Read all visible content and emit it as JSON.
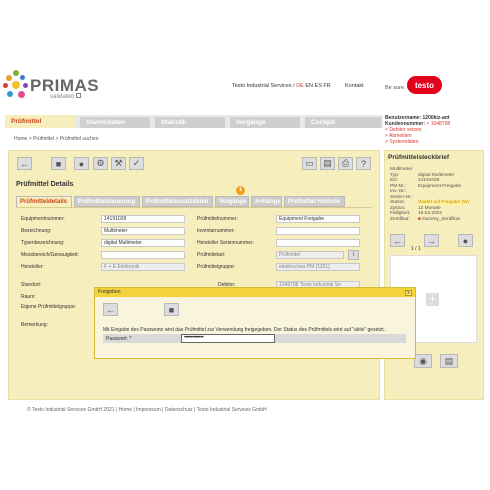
{
  "brand": {
    "name": "PRIMAS",
    "tagline": "validated"
  },
  "top": {
    "company": "Testo Industrial Services",
    "lang_sep": " / ",
    "lang_active": "DE",
    "langs_rest": " EN ES FR",
    "contact": "Kontakt",
    "be_sure": "Be sure.",
    "testo_logo": "testo"
  },
  "colors": {
    "accent": "#c9481d",
    "panel": "#f6eebc",
    "dialog_header": "#f2d33a",
    "red": "#e2001a"
  },
  "nav": {
    "items": [
      "Prüfmittel",
      "Stammdaten",
      "Statistik",
      "Vorgänge",
      "Cockpit"
    ],
    "active_index": 0
  },
  "user": {
    "label_user": "Benutzername:",
    "user": "1200kiz-ant",
    "label_customer": "Kundennummer:",
    "customer": "1048798",
    "links": [
      "Debitor setzen",
      "Abmelden",
      "Systemdaten"
    ]
  },
  "breadcrumb": "Home > Prüfmittel > Prüfmittel suchen",
  "main": {
    "title": "Prüfmittel Details",
    "tabs": [
      "Prüfmitteldetails",
      "Prüfmittelsteuerung",
      "Prüfmittelzusatzdaten",
      "Vorgänge",
      "Anhänge",
      "Prüfmittel Historie"
    ],
    "active_tab": 0,
    "badge": "1",
    "fields": {
      "equipmentnummer_label": "Equipmentnummer:",
      "equipmentnummer": "14191028",
      "bezeichnung_label": "Bezeichnung:",
      "bezeichnung": "Multimeter",
      "typenbezeichnung_label": "Typenbezeichnung:",
      "typenbezeichnung": "digital Multimeter",
      "messbereich_label": "Messbereich/Genauigkeit:",
      "messbereich": "",
      "hersteller_label": "Hersteller:",
      "hersteller": "F + E Elektronik",
      "pruefmittelnummer_label": "Prüfmittelnummer:",
      "pruefmittelnummer": "Equipment Freigabe",
      "inventarnummer_label": "Inventarnummer:",
      "inventarnummer": "",
      "herstellerserien_label": "Hersteller Seriennummer:",
      "herstellerserien": "",
      "pruefmittelart_label": "Prüfmittelart:",
      "pruefmittelart": "Prüfmittel",
      "pruefmittelgruppe_label": "Prüfmittelgruppe:",
      "pruefmittelgruppe": "elektrisches PM [1201]",
      "standort_label": "Standort:",
      "raum_label": "Raum:",
      "eigene_gruppe_label": "Eigene Prüfmittelgruppe:",
      "debitor_label": "Debitor:",
      "debitor": "1048798 Testo Industrial Se",
      "bemerkung_label": "Bemerkung:"
    }
  },
  "side": {
    "title": "Prüfmittelsteckbrief",
    "heading": "Multimeter",
    "rows": [
      {
        "k": "Typ:",
        "v": "digital Multimeter"
      },
      {
        "k": "ED:",
        "v": "14191028"
      },
      {
        "k": "PM-Nr.:",
        "v": "Equipment Freigabe"
      },
      {
        "k": "Inv.-Nr.:",
        "v": ""
      },
      {
        "k": "Serien-Nr.:",
        "v": ""
      },
      {
        "k": "Status:",
        "v": "Wartet auf Freigabe (W)"
      },
      {
        "k": "Zyklus:",
        "v": "12 Monate"
      },
      {
        "k": "Fälligkeit:",
        "v": "16.03.2022"
      },
      {
        "k": "Zertifikat:",
        "v": "Dummy_Zertifikat"
      }
    ],
    "pager": "1 / 1"
  },
  "dialog": {
    "title": "Freigeben",
    "message": "Mit Eingabe des Passworts wird das Prüfmittel zur Verwendung freigegeben. Der Status des Prüfmittels wird auf \"aktiv\" gesetzt.",
    "password_label": "Passwort: *",
    "password_value": "••••••••••••",
    "close": "x"
  },
  "footer": "© Testo Industrial Services GmbH 2021 | Home | Impressum | Datenschutz | Testo Industrial Services GmbH"
}
